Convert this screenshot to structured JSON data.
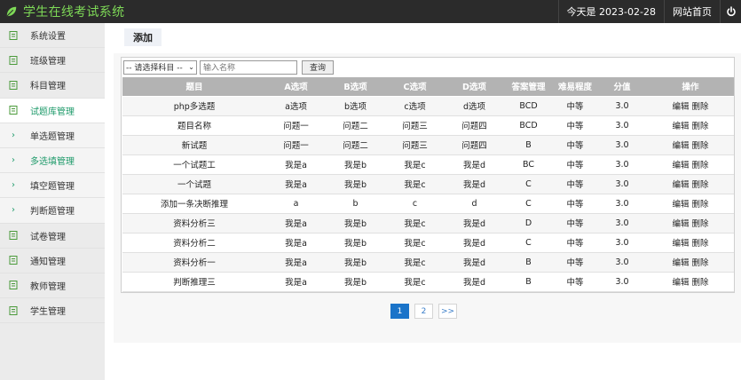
{
  "header": {
    "title": "学生在线考试系统",
    "date_text": "今天是 2023-02-28",
    "home_link": "网站首页",
    "accent_color": "#7ed957"
  },
  "sidebar": {
    "items": [
      {
        "label": "系统设置",
        "type": "main",
        "icon": "document-icon"
      },
      {
        "label": "班级管理",
        "type": "main",
        "icon": "document-icon"
      },
      {
        "label": "科目管理",
        "type": "main",
        "icon": "document-icon"
      },
      {
        "label": "试题库管理",
        "type": "main",
        "icon": "document-icon",
        "active": true
      },
      {
        "label": "单选题管理",
        "type": "sub",
        "icon": "chevron-right-icon"
      },
      {
        "label": "多选填管理",
        "type": "sub",
        "icon": "chevron-right-icon",
        "highlight": true
      },
      {
        "label": "填空题管理",
        "type": "sub",
        "icon": "chevron-right-icon"
      },
      {
        "label": "判断题管理",
        "type": "sub",
        "icon": "chevron-right-icon"
      },
      {
        "label": "试卷管理",
        "type": "main",
        "icon": "document-icon"
      },
      {
        "label": "通知管理",
        "type": "main",
        "icon": "document-icon"
      },
      {
        "label": "教师管理",
        "type": "main",
        "icon": "document-icon"
      },
      {
        "label": "学生管理",
        "type": "main",
        "icon": "document-icon"
      }
    ]
  },
  "main": {
    "add_tab": "添加",
    "filter": {
      "subject_select": "-- 请选择科目 --",
      "name_placeholder": "输入名称",
      "query_button": "查询"
    },
    "table": {
      "headers": [
        "题目",
        "A选项",
        "B选项",
        "C选项",
        "D选项",
        "答案管理",
        "难易程度",
        "分值",
        "操作"
      ],
      "rows": [
        {
          "title": "php多选题",
          "a": "a选项",
          "b": "b选项",
          "c": "c选项",
          "d": "d选项",
          "answer": "BCD",
          "difficulty": "中等",
          "score": "3.0",
          "edit": "编辑",
          "delete": "删除"
        },
        {
          "title": "题目名称",
          "a": "问题一",
          "b": "问题二",
          "c": "问题三",
          "d": "问题四",
          "answer": "BCD",
          "difficulty": "中等",
          "score": "3.0",
          "edit": "编辑",
          "delete": "删除"
        },
        {
          "title": "新试题",
          "a": "问题一",
          "b": "问题二",
          "c": "问题三",
          "d": "问题四",
          "answer": "B",
          "difficulty": "中等",
          "score": "3.0",
          "edit": "编辑",
          "delete": "删除"
        },
        {
          "title": "一个试题工",
          "a": "我是a",
          "b": "我是b",
          "c": "我是c",
          "d": "我是d",
          "answer": "BC",
          "difficulty": "中等",
          "score": "3.0",
          "edit": "编辑",
          "delete": "删除"
        },
        {
          "title": "一个试题",
          "a": "我是a",
          "b": "我是b",
          "c": "我是c",
          "d": "我是d",
          "answer": "C",
          "difficulty": "中等",
          "score": "3.0",
          "edit": "编辑",
          "delete": "删除"
        },
        {
          "title": "添加一条决断推理",
          "a": "a",
          "b": "b",
          "c": "c",
          "d": "d",
          "answer": "C",
          "difficulty": "中等",
          "score": "3.0",
          "edit": "编辑",
          "delete": "删除"
        },
        {
          "title": "资料分析三",
          "a": "我是a",
          "b": "我是b",
          "c": "我是c",
          "d": "我是d",
          "answer": "D",
          "difficulty": "中等",
          "score": "3.0",
          "edit": "编辑",
          "delete": "删除"
        },
        {
          "title": "资料分析二",
          "a": "我是a",
          "b": "我是b",
          "c": "我是c",
          "d": "我是d",
          "answer": "C",
          "difficulty": "中等",
          "score": "3.0",
          "edit": "编辑",
          "delete": "删除"
        },
        {
          "title": "资料分析一",
          "a": "我是a",
          "b": "我是b",
          "c": "我是c",
          "d": "我是d",
          "answer": "B",
          "difficulty": "中等",
          "score": "3.0",
          "edit": "编辑",
          "delete": "删除"
        },
        {
          "title": "判断推理三",
          "a": "我是a",
          "b": "我是b",
          "c": "我是c",
          "d": "我是d",
          "answer": "B",
          "difficulty": "中等",
          "score": "3.0",
          "edit": "编辑",
          "delete": "删除"
        }
      ]
    },
    "pagination": {
      "pages": [
        "1",
        "2"
      ],
      "next": ">>",
      "current": "1"
    }
  }
}
